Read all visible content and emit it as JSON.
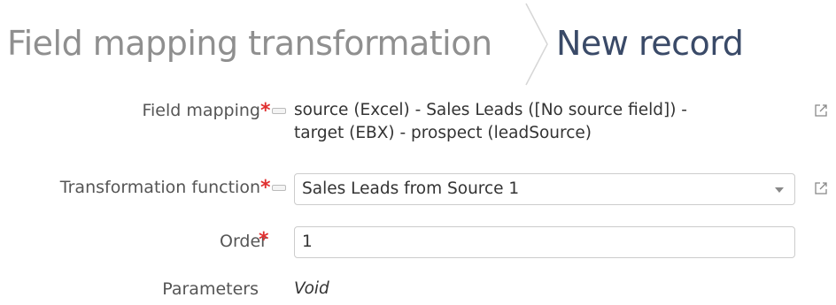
{
  "breadcrumb": {
    "parent": "Field mapping transformation",
    "current": "New record"
  },
  "form": {
    "field_mapping": {
      "label": "Field mapping",
      "required_mark": "*",
      "value_line1": "source (Excel) - Sales Leads ([No source field]) -",
      "value_line2": "target (EBX) - prospect (leadSource)"
    },
    "transformation_function": {
      "label": "Transformation function",
      "required_mark": "*",
      "selected": "Sales Leads from Source 1"
    },
    "order": {
      "label": "Order",
      "required_mark": "*",
      "value": "1"
    },
    "parameters": {
      "label": "Parameters",
      "value": "Void"
    }
  },
  "colors": {
    "breadcrumb_parent": "#8f8f8f",
    "breadcrumb_current": "#3a4a68",
    "required": "#e03030",
    "border": "#cccccc"
  },
  "icons": [
    "chevron-separator-icon",
    "external-link-icon",
    "link-indicator-icon",
    "dropdown-caret-icon"
  ]
}
